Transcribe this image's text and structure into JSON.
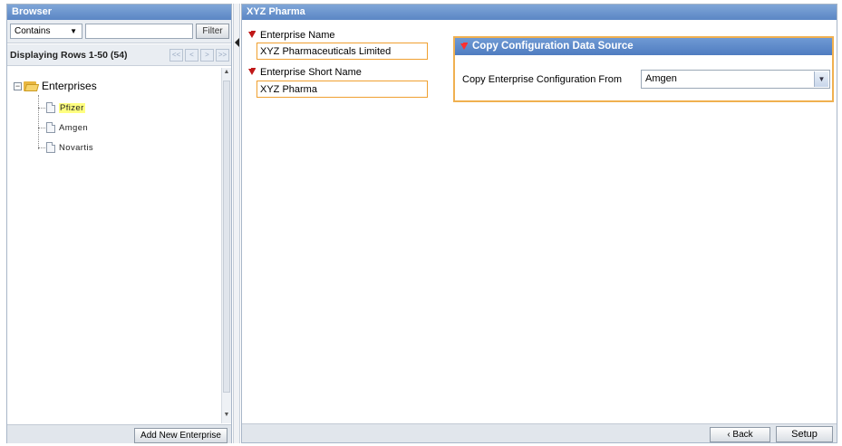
{
  "browser": {
    "title": "Browser",
    "filter": {
      "mode": "Contains",
      "value": "",
      "button_label": "Filter"
    },
    "paging": {
      "label": "Displaying Rows 1-50 (54)",
      "first": "<<",
      "prev": "<",
      "next": ">",
      "last": ">>"
    },
    "tree": {
      "expander": "−",
      "root_label": "Enterprises",
      "items": [
        {
          "label": "Pfizer",
          "selected": true
        },
        {
          "label": "Amgen",
          "selected": false
        },
        {
          "label": "Novartis",
          "selected": false
        }
      ]
    },
    "add_button_label": "Add New Enterprise"
  },
  "main": {
    "title": "XYZ Pharma",
    "enterprise_name": {
      "label": "Enterprise Name",
      "value": "XYZ Pharmaceuticals Limited"
    },
    "enterprise_short_name": {
      "label": "Enterprise Short Name",
      "value": "XYZ Pharma"
    },
    "copy_config": {
      "title": "Copy Configuration Data Source",
      "label": "Copy Enterprise Configuration From",
      "selected": "Amgen"
    },
    "back_label": "‹ Back",
    "setup_label": "Setup"
  },
  "colors": {
    "header_blue": "#5b86c4",
    "required_red": "#c01818",
    "field_border_orange": "#f0a030",
    "selection_yellow": "#ffff80"
  }
}
